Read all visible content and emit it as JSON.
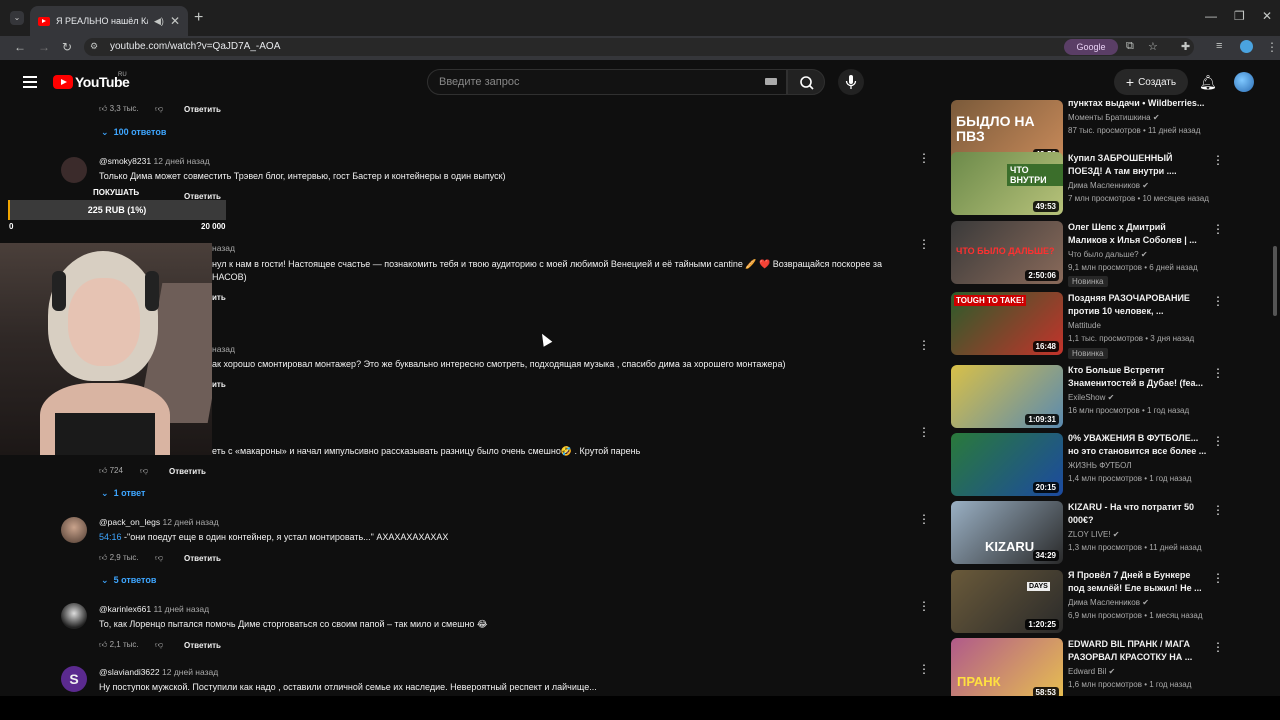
{
  "browser": {
    "tab_title": "Я РЕАЛЬНО нашёл Клад в...",
    "tab_close": "✕",
    "new_tab": "+",
    "url": "youtube.com/watch?v=QaJD7A_-AOA",
    "google_pill": "Google",
    "controls": {
      "minimize": "—",
      "maximize": "❐",
      "close": "✕"
    }
  },
  "header": {
    "logo_text": "YouTube",
    "logo_region": "RU",
    "search_placeholder": "Введите запрос",
    "create_label": "Создать"
  },
  "overlay": {
    "buy_label": "ПОКУШАТЬ",
    "progress_text": "225 RUB (1%)",
    "min_label": "0",
    "max_label": "20 000",
    "progress_fraction": 0.01
  },
  "comments": [
    {
      "likes": "3,3 тыс.",
      "reply": "Ответить",
      "replies_label": "100 ответов"
    },
    {
      "author": "@smoky8231",
      "time": "12 дней назад",
      "text": "Только Дима может совместить Трэвел блог, интервью, гост Бастер и контейнеры в один выпуск)",
      "reply": "Ответить"
    },
    {
      "time": "назад",
      "text": "нул к нам в гости! Настоящее счастье — познакомить тебя и твою аудиторию с моей любимой Венецией и её тайными cantine 🥖 ❤️ Возвращайся поскорее за",
      "text2": "НАСОВ)",
      "reply": "ить"
    },
    {
      "time": "назад",
      "text": "ак хорошо смонтировал монтажер? Это же буквально интересно смотреть, подходящая музыка , спасибо дима за хорошего монтажера)",
      "reply": "ить"
    },
    {
      "text": "еть с «макароны» и начал импульсивно рассказывать разницу было очень смешно🤣 . Крутой парень",
      "likes": "724",
      "reply": "Ответить",
      "replies_label": "1 ответ"
    },
    {
      "author": "@pack_on_legs",
      "time": "12 дней назад",
      "timestamp": "54:16",
      "text": " -\"они поедут еще в один контейнер, я устал монтировать...\" АХАХАХАХАХАХ",
      "likes": "2,9 тыс.",
      "reply": "Ответить",
      "replies_label": "5 ответов"
    },
    {
      "author": "@karinlex661",
      "time": "11 дней назад",
      "text": "То, как Лоренцо пытался помочь Диме сторговаться со своим папой – так мило и смешно 😂",
      "likes": "2,1 тыс.",
      "reply": "Ответить"
    },
    {
      "author": "@slaviandi3622",
      "time": "12 дней назад",
      "text": "Ну поступок мужской. Поступили как надо , оставили отличной семье их наследие. Невероятный респект и лайчище..."
    }
  ],
  "related": [
    {
      "title1": "пунктах выдачи • Wildberries...",
      "channel": "Моменты Братишкина",
      "meta": "87 тыс. просмотров • 11 дней назад",
      "duration": "42:56",
      "thumb_text": "БЫДЛО НА ПВЗ"
    },
    {
      "title1": "Купил ЗАБРОШЕННЫЙ",
      "title2": "ПОЕЗД! А там внутри ....",
      "channel": "Дима Масленников",
      "meta": "7 млн просмотров • 10 месяцев назад",
      "duration": "49:53",
      "thumb_text": "ЧТО ВНУТРИ"
    },
    {
      "title1": "Олег Шепс х Дмитрий",
      "title2": "Маликов х Илья Соболев | ...",
      "channel": "Что было дальше?",
      "meta": "9,1 млн просмотров • 6 дней назад",
      "badge": "Новинка",
      "duration": "2:50:06",
      "thumb_text": "ЧТО БЫЛО ДАЛЬШЕ?"
    },
    {
      "title1": "Поздняя РАЗОЧАРОВАНИЕ",
      "title2": "против 10 человек, ...",
      "channel": "Mattitude",
      "meta": "1,1 тыс. просмотров • 3 дня назад",
      "badge": "Новинка",
      "duration": "16:48",
      "thumb_text": "TOUGH TO TAKE!"
    },
    {
      "title1": "Кто Больше Встретит",
      "title2": "Знаменитостей в Дубае! (fea...",
      "channel": "ExileShow",
      "meta": "16 млн просмотров • 1 год назад",
      "duration": "1:09:31"
    },
    {
      "title1": "0% УВАЖЕНИЯ В ФУТБОЛЕ...",
      "title2": "но это становится все более ...",
      "channel": "ЖИЗНЬ ФУТБОЛ",
      "meta": "1,4 млн просмотров • 1 год назад",
      "duration": "20:15"
    },
    {
      "title1": "KIZARU - На что потратит 50",
      "title2": "000€?",
      "channel": "ZLOY LIVE!",
      "meta": "1,3 млн просмотров • 11 дней назад",
      "duration": "34:29",
      "thumb_text": "KIZARU"
    },
    {
      "title1": "Я Провёл 7 Дней в Бункере",
      "title2": "под землёй! Еле выжил! Не ...",
      "channel": "Дима Масленников",
      "meta": "6,9 млн просмотров • 1 месяц назад",
      "duration": "1:20:25",
      "thumb_text": "DAYS"
    },
    {
      "title1": "EDWARD BIL ПРАНК / МАГА",
      "title2": "РАЗОРВАЛ КРАСОТКУ НА ...",
      "channel": "Edward Bil",
      "meta": "1,6 млн просмотров • 1 год назад",
      "duration": "58:53",
      "thumb_text": "ПРАНК"
    }
  ],
  "colors": {
    "background": "#0f0f0f",
    "link": "#3ea6ff",
    "brand": "#ff0000"
  }
}
